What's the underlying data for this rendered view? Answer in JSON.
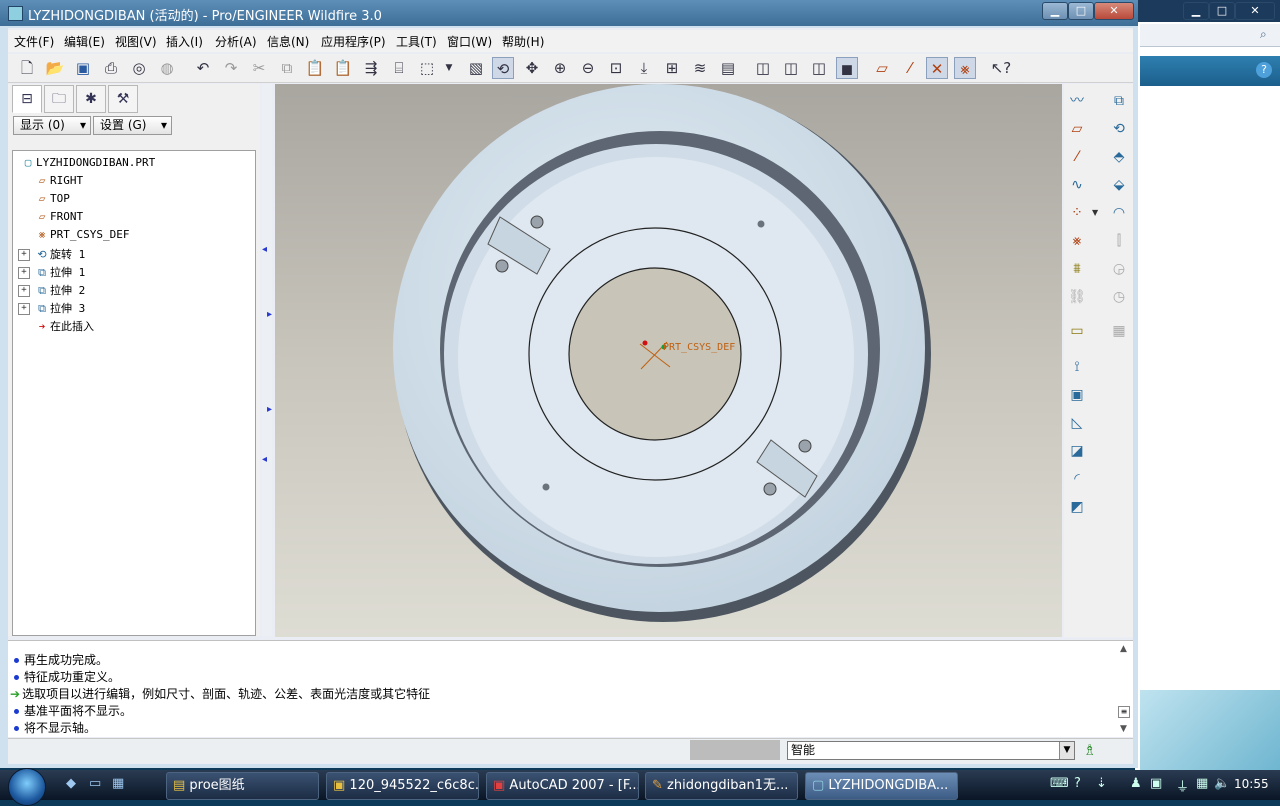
{
  "window": {
    "title": "LYZHIDONGDIBAN (活动的) - Pro/ENGINEER Wildfire 3.0",
    "min_label": "▁",
    "max_label": "□",
    "close_label": "✕"
  },
  "menu": [
    "文件(F)",
    "编辑(E)",
    "视图(V)",
    "插入(I)",
    "分析(A)",
    "信息(N)",
    "应用程序(P)",
    "工具(T)",
    "窗口(W)",
    "帮助(H)"
  ],
  "toolbar_icons": [
    "new-icon",
    "open-icon",
    "save-icon",
    "print-icon",
    "preview-icon",
    "email-icon",
    "undo-icon",
    "redo-icon",
    "cut-icon",
    "copy-icon",
    "paste-icon",
    "paste-special-icon",
    "regenerate-icon",
    "find-icon",
    "select-box-icon",
    "dropdown-icon",
    "repaint-icon",
    "spin-center-icon",
    "orient-icon",
    "zoom-in-icon",
    "zoom-out-icon",
    "refit-icon",
    "reorient-icon",
    "saved-views-icon",
    "layers-icon",
    "view-manager-icon",
    "wireframe-icon",
    "hidden-line-icon",
    "no-hidden-icon",
    "shading-icon",
    "datum-planes-icon",
    "datum-axes-icon",
    "datum-points-icon",
    "csys-icon",
    "context-help-icon"
  ],
  "panel": {
    "tabs": [
      "model-tree-icon",
      "folder-browser-icon",
      "favorites-icon",
      "connections-icon"
    ],
    "show_label": "显示 (0)",
    "settings_label": "设置 (G)"
  },
  "tree": [
    {
      "label": "LYZHIDONGDIBAN.PRT",
      "icon": "part-icon",
      "expand": false
    },
    {
      "label": "RIGHT",
      "icon": "datum-plane-icon",
      "expand": false
    },
    {
      "label": "TOP",
      "icon": "datum-plane-icon",
      "expand": false
    },
    {
      "label": "FRONT",
      "icon": "datum-plane-icon",
      "expand": false
    },
    {
      "label": "PRT_CSYS_DEF",
      "icon": "csys-icon",
      "expand": false
    },
    {
      "label": "旋转 1",
      "icon": "revolve-icon",
      "expand": true
    },
    {
      "label": "拉伸 1",
      "icon": "extrude-icon",
      "expand": true
    },
    {
      "label": "拉伸 2",
      "icon": "extrude-icon",
      "expand": true
    },
    {
      "label": "拉伸 3",
      "icon": "extrude-icon",
      "expand": true
    },
    {
      "label": "在此插入",
      "icon": "insert-here-arrow-icon",
      "expand": false
    }
  ],
  "viewport": {
    "csys_label": "PRT_CSYS_DEF"
  },
  "messages": [
    {
      "text": "再生成功完成。",
      "type": "info"
    },
    {
      "text": "特征成功重定义。",
      "type": "info"
    },
    {
      "text": "选取项目以进行编辑，例如尺寸、剖面、轨迹、公差、表面光洁度或其它特征",
      "type": "prompt"
    },
    {
      "text": "基准平面将不显示。",
      "type": "info"
    },
    {
      "text": "将不显示轴。",
      "type": "info"
    }
  ],
  "status": {
    "filter_value": "智能"
  },
  "right_toolbar_icons": [
    "sketch-datum-curve-icon",
    "datum-plane-tool-icon",
    "datum-axis-tool-icon",
    "datum-curve-icon",
    "datum-point-icon",
    "csys-tool-icon",
    "analysis-feature-icon",
    "ref-icon",
    "sketch-tool-icon",
    "hole-icon",
    "shell-icon",
    "rib-icon",
    "draft-icon",
    "round-icon",
    "chamfer-icon",
    "extrude-tool-icon",
    "revolve-tool-icon",
    "sweep-icon",
    "blend-icon",
    "style-icon",
    "mirror-icon",
    "merge-icon",
    "trim-icon",
    "pattern-icon"
  ],
  "taskbar": {
    "tasks": [
      {
        "label": "proe图纸",
        "icon": "folder-icon",
        "active": false
      },
      {
        "label": "120_945522_c6c8c...",
        "icon": "image-icon",
        "active": false
      },
      {
        "label": "AutoCAD 2007 - [F...",
        "icon": "autocad-icon",
        "active": false
      },
      {
        "label": "zhidongdiban1无...",
        "icon": "browser-icon",
        "active": false
      },
      {
        "label": "LYZHIDONGDIBA...",
        "icon": "proe-icon",
        "active": true
      }
    ],
    "clock": "10:55"
  }
}
